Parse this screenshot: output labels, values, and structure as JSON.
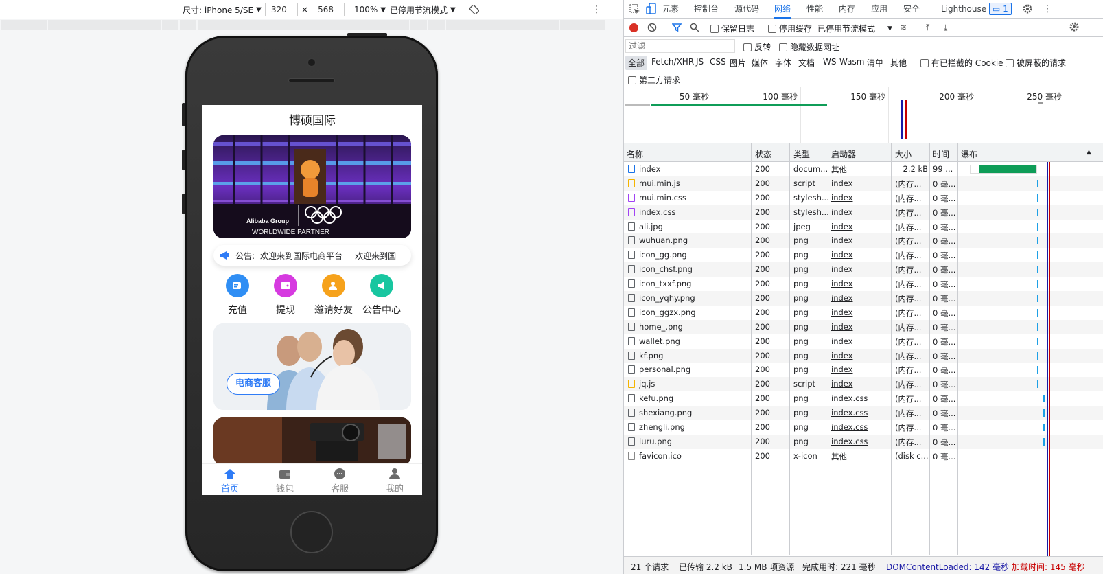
{
  "device_toolbar": {
    "device_label": "尺寸: iPhone 5/SE",
    "width": "320",
    "height": "568",
    "times": "×",
    "zoom": "100%",
    "throttle": "已停用节流模式"
  },
  "mobile": {
    "title": "博硕国际",
    "banner_text_1": "Alibaba Group",
    "banner_text_2": "WORLDWIDE PARTNER",
    "notice_label": "公告:",
    "notice_text": "欢迎来到国际电商平台",
    "notice_text_2": "欢迎来到国",
    "quick": [
      {
        "label": "充值",
        "color": "#2f8ef4"
      },
      {
        "label": "提现",
        "color": "#d63ae0"
      },
      {
        "label": "邀请好友",
        "color": "#f6a21b"
      },
      {
        "label": "公告中心",
        "color": "#18c6a0"
      }
    ],
    "service_label": "电商客服",
    "tabs": [
      {
        "label": "首页"
      },
      {
        "label": "钱包"
      },
      {
        "label": "客服"
      },
      {
        "label": "我的"
      }
    ]
  },
  "devtools": {
    "tabs": [
      "元素",
      "控制台",
      "源代码",
      "网络",
      "性能",
      "内存",
      "应用",
      "安全",
      "Lighthouse"
    ],
    "active_tab": "网络",
    "issues_count": "1",
    "toolbar": {
      "preserve_log": "保留日志",
      "disable_cache": "停用缓存",
      "throttle": "已停用节流模式"
    },
    "filter_placeholder": "过滤",
    "invert": "反转",
    "hide_data_urls": "隐藏数据网址",
    "types": [
      "全部",
      "Fetch/XHR",
      "JS",
      "CSS",
      "图片",
      "媒体",
      "字体",
      "文档",
      "WS",
      "Wasm",
      "清单",
      "其他"
    ],
    "blocked_cookies": "有已拦截的 Cookie",
    "blocked_requests": "被屏蔽的请求",
    "third_party": "第三方请求",
    "overview_ticks": [
      "50 毫秒",
      "100 毫秒",
      "150 毫秒",
      "200 毫秒",
      "250 毫秒"
    ],
    "columns": [
      "名称",
      "状态",
      "类型",
      "启动器",
      "大小",
      "时间",
      "瀑布"
    ],
    "rows": [
      {
        "name": "index",
        "status": "200",
        "type": "docum...",
        "initiator": "其他",
        "size": "2.2 kB",
        "time": "99 ...",
        "kind": "doc"
      },
      {
        "name": "mui.min.js",
        "status": "200",
        "type": "script",
        "initiator": "index",
        "size": "(内存...",
        "time": "0 毫...",
        "kind": "js"
      },
      {
        "name": "mui.min.css",
        "status": "200",
        "type": "stylesh...",
        "initiator": "index",
        "size": "(内存...",
        "time": "0 毫...",
        "kind": "css"
      },
      {
        "name": "index.css",
        "status": "200",
        "type": "stylesh...",
        "initiator": "index",
        "size": "(内存...",
        "time": "0 毫...",
        "kind": "css"
      },
      {
        "name": "ali.jpg",
        "status": "200",
        "type": "jpeg",
        "initiator": "index",
        "size": "(内存...",
        "time": "0 毫...",
        "kind": "img"
      },
      {
        "name": "wuhuan.png",
        "status": "200",
        "type": "png",
        "initiator": "index",
        "size": "(内存...",
        "time": "0 毫...",
        "kind": "img"
      },
      {
        "name": "icon_gg.png",
        "status": "200",
        "type": "png",
        "initiator": "index",
        "size": "(内存...",
        "time": "0 毫...",
        "kind": "img"
      },
      {
        "name": "icon_chsf.png",
        "status": "200",
        "type": "png",
        "initiator": "index",
        "size": "(内存...",
        "time": "0 毫...",
        "kind": "img"
      },
      {
        "name": "icon_txxf.png",
        "status": "200",
        "type": "png",
        "initiator": "index",
        "size": "(内存...",
        "time": "0 毫...",
        "kind": "img"
      },
      {
        "name": "icon_yqhy.png",
        "status": "200",
        "type": "png",
        "initiator": "index",
        "size": "(内存...",
        "time": "0 毫...",
        "kind": "img"
      },
      {
        "name": "icon_ggzx.png",
        "status": "200",
        "type": "png",
        "initiator": "index",
        "size": "(内存...",
        "time": "0 毫...",
        "kind": "img"
      },
      {
        "name": "home_.png",
        "status": "200",
        "type": "png",
        "initiator": "index",
        "size": "(内存...",
        "time": "0 毫...",
        "kind": "img"
      },
      {
        "name": "wallet.png",
        "status": "200",
        "type": "png",
        "initiator": "index",
        "size": "(内存...",
        "time": "0 毫...",
        "kind": "img"
      },
      {
        "name": "kf.png",
        "status": "200",
        "type": "png",
        "initiator": "index",
        "size": "(内存...",
        "time": "0 毫...",
        "kind": "img"
      },
      {
        "name": "personal.png",
        "status": "200",
        "type": "png",
        "initiator": "index",
        "size": "(内存...",
        "time": "0 毫...",
        "kind": "img"
      },
      {
        "name": "jq.js",
        "status": "200",
        "type": "script",
        "initiator": "index",
        "size": "(内存...",
        "time": "0 毫...",
        "kind": "js"
      },
      {
        "name": "kefu.png",
        "status": "200",
        "type": "png",
        "initiator": "index.css",
        "size": "(内存...",
        "time": "0 毫...",
        "kind": "img"
      },
      {
        "name": "shexiang.png",
        "status": "200",
        "type": "png",
        "initiator": "index.css",
        "size": "(内存...",
        "time": "0 毫...",
        "kind": "img"
      },
      {
        "name": "zhengli.png",
        "status": "200",
        "type": "png",
        "initiator": "index.css",
        "size": "(内存...",
        "time": "0 毫...",
        "kind": "img"
      },
      {
        "name": "luru.png",
        "status": "200",
        "type": "png",
        "initiator": "index.css",
        "size": "(内存...",
        "time": "0 毫...",
        "kind": "img"
      },
      {
        "name": "favicon.ico",
        "status": "200",
        "type": "x-icon",
        "initiator": "其他",
        "size": "(disk c...",
        "time": "0 毫...",
        "kind": "other"
      }
    ],
    "status_bar": {
      "requests": "21 个请求",
      "transferred": "已传输 2.2 kB",
      "resources": "1.5 MB 项资源",
      "finish": "完成用时: 221 毫秒",
      "dom_loaded": "DOMContentLoaded: 142 毫秒",
      "load": "加载时间: 145 毫秒"
    },
    "colors": {
      "accent": "#1a73e8",
      "dom": "#1a1aa6",
      "load": "#c80000",
      "record": "#d93025",
      "waterfall_green": "#0f9d58"
    }
  }
}
